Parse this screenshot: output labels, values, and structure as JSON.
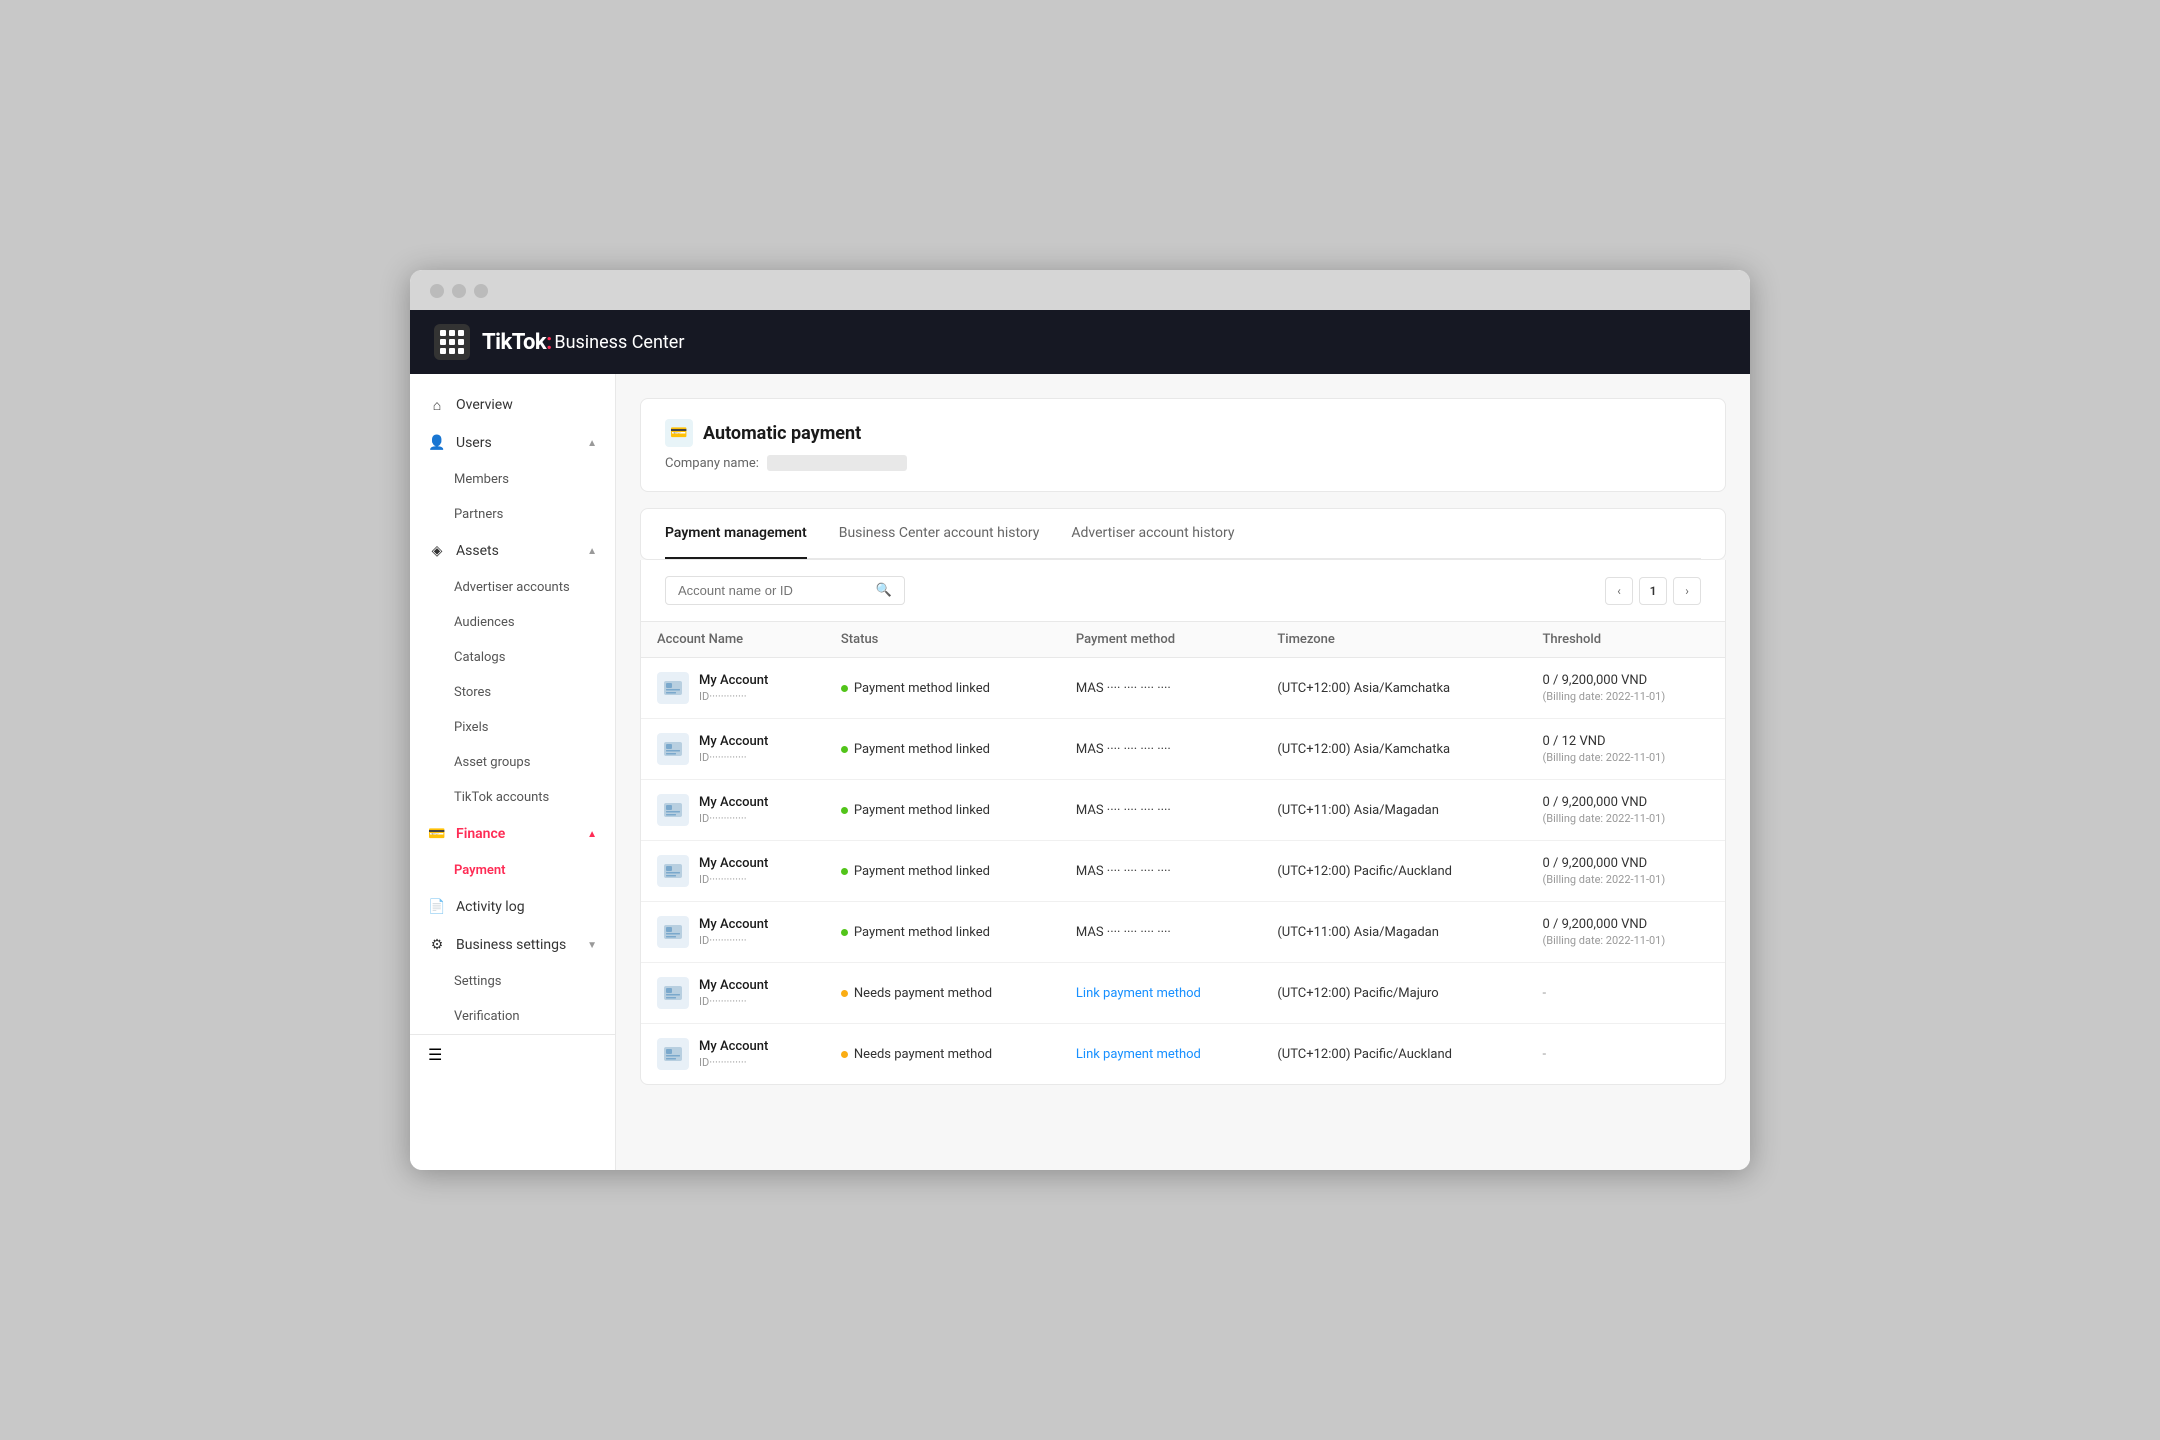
{
  "header": {
    "logo_tiktok": "TikTok",
    "logo_colon": ":",
    "logo_bc": " Business Center"
  },
  "sidebar": {
    "overview_label": "Overview",
    "users_label": "Users",
    "members_label": "Members",
    "partners_label": "Partners",
    "assets_label": "Assets",
    "advertiser_accounts_label": "Advertiser accounts",
    "audiences_label": "Audiences",
    "catalogs_label": "Catalogs",
    "stores_label": "Stores",
    "pixels_label": "Pixels",
    "asset_groups_label": "Asset groups",
    "tiktok_accounts_label": "TikTok accounts",
    "finance_label": "Finance",
    "payment_label": "Payment",
    "activity_log_label": "Activity log",
    "business_settings_label": "Business settings",
    "settings_label": "Settings",
    "verification_label": "Verification"
  },
  "page": {
    "title": "Automatic payment",
    "company_label": "Company name:"
  },
  "tabs": {
    "payment_management": "Payment management",
    "bc_account_history": "Business Center account history",
    "advertiser_account_history": "Advertiser account history"
  },
  "search": {
    "placeholder": "Account name or ID"
  },
  "pagination": {
    "current_page": "1"
  },
  "table": {
    "col_account_name": "Account Name",
    "col_status": "Status",
    "col_payment_method": "Payment method",
    "col_timezone": "Timezone",
    "col_threshold": "Threshold",
    "rows": [
      {
        "name": "My Account",
        "id": "ID·············",
        "status": "linked",
        "status_text": "Payment method linked",
        "payment": "MAS ···· ···· ···· ····",
        "timezone": "(UTC+12:00) Asia/Kamchatka",
        "threshold_main": "0 / 9,200,000 VND",
        "threshold_sub": "(Billing date: 2022-11-01)"
      },
      {
        "name": "My Account",
        "id": "ID·············",
        "status": "linked",
        "status_text": "Payment method linked",
        "payment": "MAS ···· ···· ···· ····",
        "timezone": "(UTC+12:00) Asia/Kamchatka",
        "threshold_main": "0 / 12 VND",
        "threshold_sub": "(Billing date: 2022-11-01)"
      },
      {
        "name": "My Account",
        "id": "ID·············",
        "status": "linked",
        "status_text": "Payment method linked",
        "payment": "MAS ···· ···· ···· ····",
        "timezone": "(UTC+11:00) Asia/Magadan",
        "threshold_main": "0 / 9,200,000 VND",
        "threshold_sub": "(Billing date: 2022-11-01)"
      },
      {
        "name": "My Account",
        "id": "ID·············",
        "status": "linked",
        "status_text": "Payment method linked",
        "payment": "MAS ···· ···· ···· ····",
        "timezone": "(UTC+12:00) Pacific/Auckland",
        "threshold_main": "0 / 9,200,000 VND",
        "threshold_sub": "(Billing date: 2022-11-01)"
      },
      {
        "name": "My Account",
        "id": "ID·············",
        "status": "linked",
        "status_text": "Payment method linked",
        "payment": "MAS ···· ···· ···· ····",
        "timezone": "(UTC+11:00) Asia/Magadan",
        "threshold_main": "0 / 9,200,000 VND",
        "threshold_sub": "(Billing date: 2022-11-01)"
      },
      {
        "name": "My Account",
        "id": "ID·············",
        "status": "needs",
        "status_text": "Needs payment method",
        "payment": "link",
        "payment_link_text": "Link payment method",
        "timezone": "(UTC+12:00) Pacific/Majuro",
        "threshold_main": "-",
        "threshold_sub": ""
      },
      {
        "name": "My Account",
        "id": "ID·············",
        "status": "needs",
        "status_text": "Needs payment method",
        "payment": "link",
        "payment_link_text": "Link payment method",
        "timezone": "(UTC+12:00) Pacific/Auckland",
        "threshold_main": "-",
        "threshold_sub": ""
      }
    ]
  }
}
